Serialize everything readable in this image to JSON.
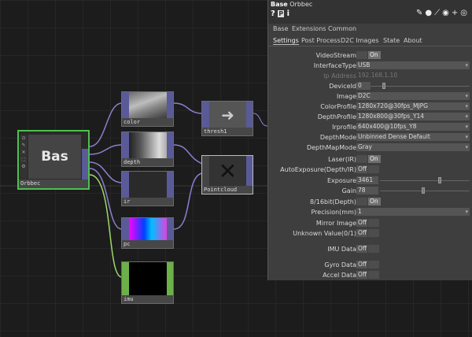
{
  "panel": {
    "header": {
      "type": "Base",
      "name": "Orbbec",
      "help": "?",
      "info": "i",
      "python_icon": "?"
    },
    "tabs_top": [
      "Base",
      "Extensions",
      "Common"
    ],
    "tabs_page": [
      "Settings",
      "Post Process",
      "D2C Images",
      "State",
      "About"
    ],
    "params": {
      "videostream": {
        "label": "VideoStream",
        "value": "On"
      },
      "interfacetype": {
        "label": "InterfaceType",
        "value": "USB"
      },
      "ipaddress": {
        "label": "Ip Address",
        "value": "192.168.1.10"
      },
      "deviceid": {
        "label": "DeviceId",
        "value": "0"
      },
      "image": {
        "label": "Image",
        "value": "D2C"
      },
      "colorprofile": {
        "label": "ColorProfile",
        "value": "1280x720@30fps_MJPG"
      },
      "depthprofile": {
        "label": "DepthProfile",
        "value": "1280x800@30fps_Y14"
      },
      "irprofile": {
        "label": "Irprofile",
        "value": "640x400@10fps_Y8"
      },
      "depthmode": {
        "label": "DepthMode",
        "value": "Unbinned Dense Default"
      },
      "depthmapmode": {
        "label": "DepthMapMode",
        "value": "Gray"
      },
      "laser": {
        "label": "Laser(IR)",
        "value": "On"
      },
      "autoexposure": {
        "label": "AutoExposure(Depth/IR)",
        "value": "Off"
      },
      "exposure": {
        "label": "Exposure",
        "value": "3461"
      },
      "gain": {
        "label": "Gain",
        "value": "78"
      },
      "bit": {
        "label": "8/16bit(Depth)",
        "value": "On"
      },
      "precision": {
        "label": "Precision(mm)",
        "value": "1"
      },
      "mirror": {
        "label": "Mirror Image",
        "value": "Off"
      },
      "unknown": {
        "label": "Unknown Value(0/1)",
        "value": "Off"
      },
      "imu": {
        "label": "IMU Data",
        "value": "Off"
      },
      "gyro": {
        "label": "Gyro Data",
        "value": "Off"
      },
      "accel": {
        "label": "Accel Data",
        "value": "Off"
      }
    }
  },
  "network": {
    "base_node": {
      "title": "Bas",
      "label": "Orbbec"
    },
    "nodes": {
      "color": "color",
      "depth": "depth",
      "ir": "ir",
      "pc": "pc",
      "imu": "imu",
      "thresh": "thresh1",
      "pointcloud": "Pointcloud"
    }
  }
}
